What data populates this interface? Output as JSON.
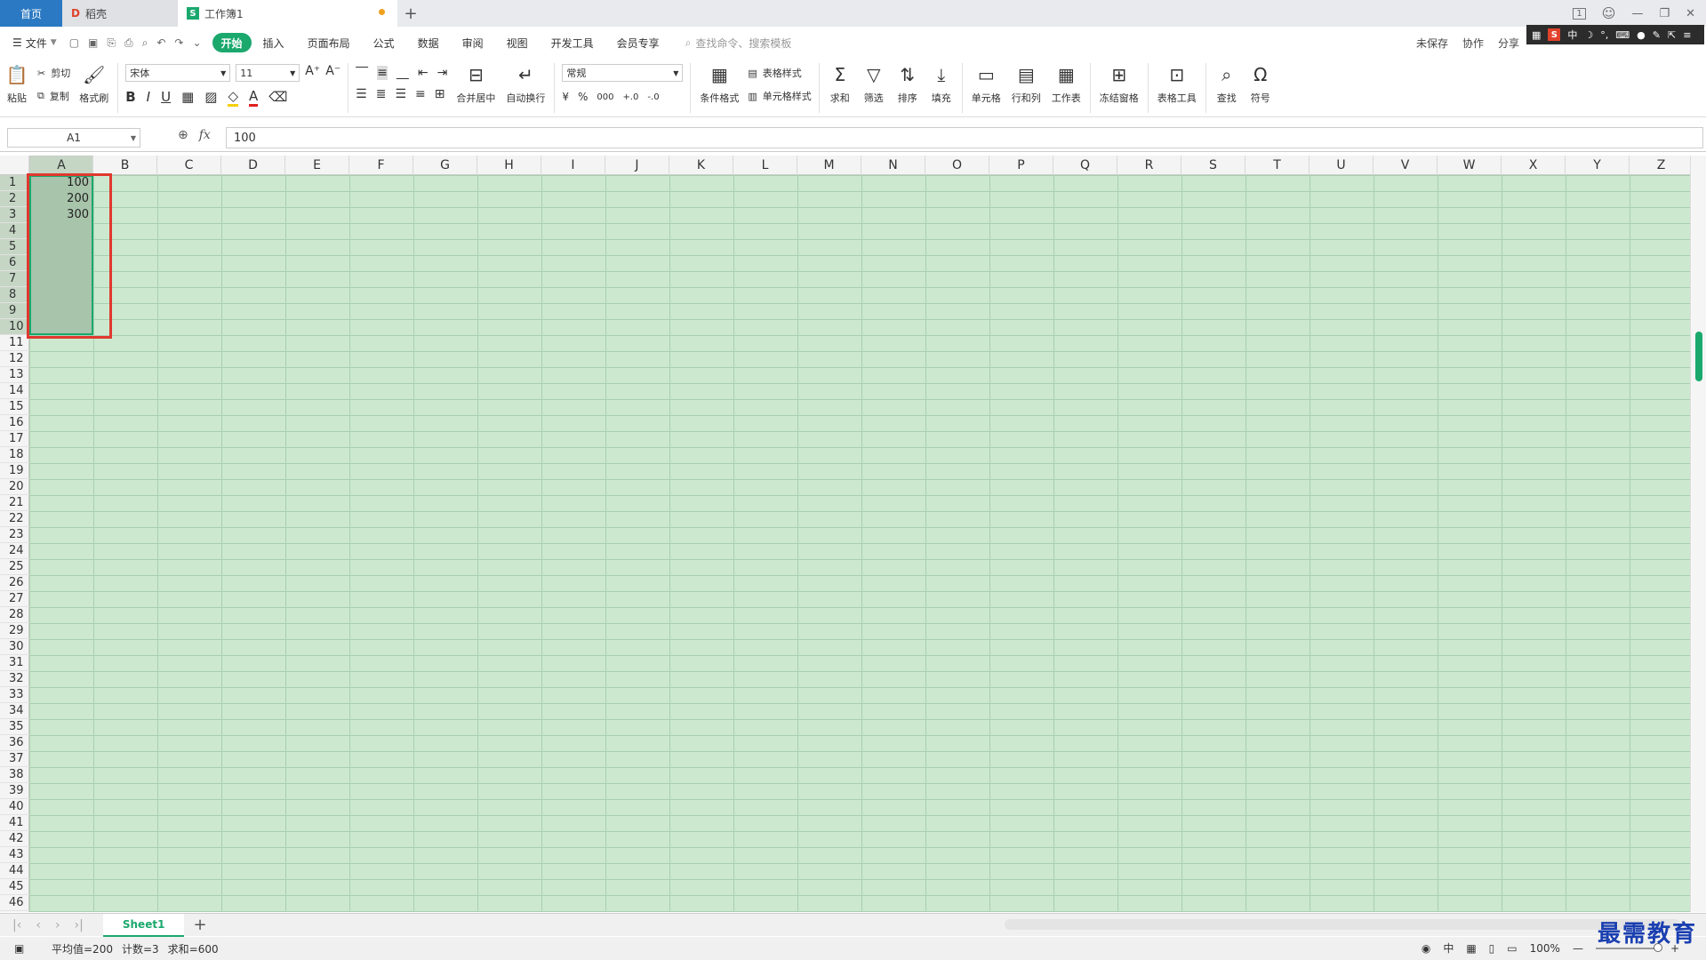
{
  "tabs": {
    "home": "首页",
    "daoke": "稻壳",
    "workbook": "工作簿1",
    "add": "+"
  },
  "window": {
    "minimize": "—",
    "restore": "❐",
    "close": "✕",
    "badge": "1"
  },
  "ime": {
    "mode": "中",
    "moon": "☽",
    "dots": "°,"
  },
  "menu": {
    "file": "文件",
    "tabs": [
      "开始",
      "插入",
      "页面布局",
      "公式",
      "数据",
      "审阅",
      "视图",
      "开发工具",
      "会员专享"
    ],
    "search_placeholder": "查找命令、搜索模板",
    "right": [
      "未保存",
      "协作",
      "分享"
    ]
  },
  "ribbon": {
    "paste": "粘贴",
    "cut": "剪切",
    "copy": "复制",
    "format_painter": "格式刷",
    "font_name": "宋体",
    "font_size": "11",
    "merge_center": "合并居中",
    "auto_wrap": "自动换行",
    "number_format": "常规",
    "table_style": "表格样式",
    "cond_format": "条件格式",
    "cell_style": "单元格样式",
    "sum": "求和",
    "filter": "筛选",
    "sort": "排序",
    "fill": "填充",
    "cell": "单元格",
    "row_col": "行和列",
    "worksheet": "工作表",
    "freeze": "冻结窗格",
    "table_tools": "表格工具",
    "find": "查找",
    "symbol": "符号",
    "fmt_bold": "B",
    "fmt_italic": "I",
    "fmt_underline": "U",
    "fmt_fontcolor": "A",
    "currency": "¥",
    "percent": "%",
    "thousands": "000",
    "inc_decimal": "+.0",
    "dec_decimal": "-.0",
    "font_grow": "A⁺",
    "font_shrink": "A⁻"
  },
  "formula_bar": {
    "cell_ref": "A1",
    "fx": "fx",
    "value": "100"
  },
  "columns": [
    "A",
    "B",
    "C",
    "D",
    "E",
    "F",
    "G",
    "H",
    "I",
    "J",
    "K",
    "L",
    "M",
    "N",
    "O",
    "P",
    "Q",
    "R",
    "S",
    "T",
    "U",
    "V",
    "W",
    "X",
    "Y",
    "Z"
  ],
  "rows": [
    "1",
    "2",
    "3",
    "4",
    "5",
    "6",
    "7",
    "8",
    "9",
    "10",
    "11",
    "12",
    "13",
    "14",
    "15",
    "16",
    "17",
    "18",
    "19",
    "20",
    "21",
    "22",
    "23",
    "24",
    "25",
    "26",
    "27",
    "28",
    "29",
    "30",
    "31",
    "32",
    "33",
    "34",
    "35",
    "36",
    "37",
    "38",
    "39",
    "40",
    "41",
    "42",
    "43",
    "44",
    "45",
    "46"
  ],
  "cells": {
    "A1": "100",
    "A2": "200",
    "A3": "300"
  },
  "sheet_tabs": [
    "Sheet1"
  ],
  "status": {
    "avg": "平均值=200",
    "count": "计数=3",
    "sum": "求和=600",
    "zoom": "100%",
    "ime": "中"
  },
  "watermark": "最需教育",
  "colors": {
    "accent": "#1aa86d",
    "grid_bg": "#cce8cf",
    "highlight": "#e0382e",
    "home_tab": "#2b79c2"
  }
}
